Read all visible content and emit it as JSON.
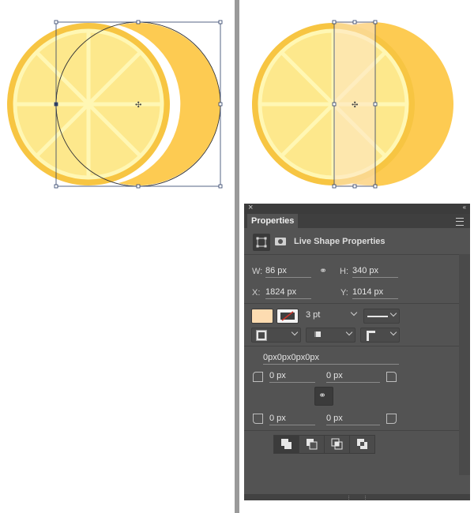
{
  "colors": {
    "rind": "#f7c542",
    "rind_dark": "#fdcb52",
    "pulp": "#fde88c",
    "segment_line": "#fff7b4",
    "highlight_shape": "#fde5c8",
    "path_stroke": "#2c3e66",
    "panel_bg": "#535353",
    "fill_swatch": "#fddcb1"
  },
  "panel": {
    "close_label": "×",
    "collapse_label": "‹‹",
    "tab_label": "Properties",
    "menu_icon": "menu-lines-icon",
    "header": {
      "shape_icon": "transform-rect-icon",
      "mask_icon": "mask-icon",
      "title": "Live Shape Properties"
    },
    "w_label": "W:",
    "w_value": "86 px",
    "h_label": "H:",
    "h_value": "340 px",
    "x_label": "X:",
    "x_value": "1824 px",
    "y_label": "Y:",
    "y_value": "1014 px",
    "stroke_width": "3 pt",
    "corner_radius_combined": "0px0px0px0px",
    "radius_tl": "0 px",
    "radius_tr": "0 px",
    "radius_bl": "0 px",
    "radius_br": "0 px"
  }
}
